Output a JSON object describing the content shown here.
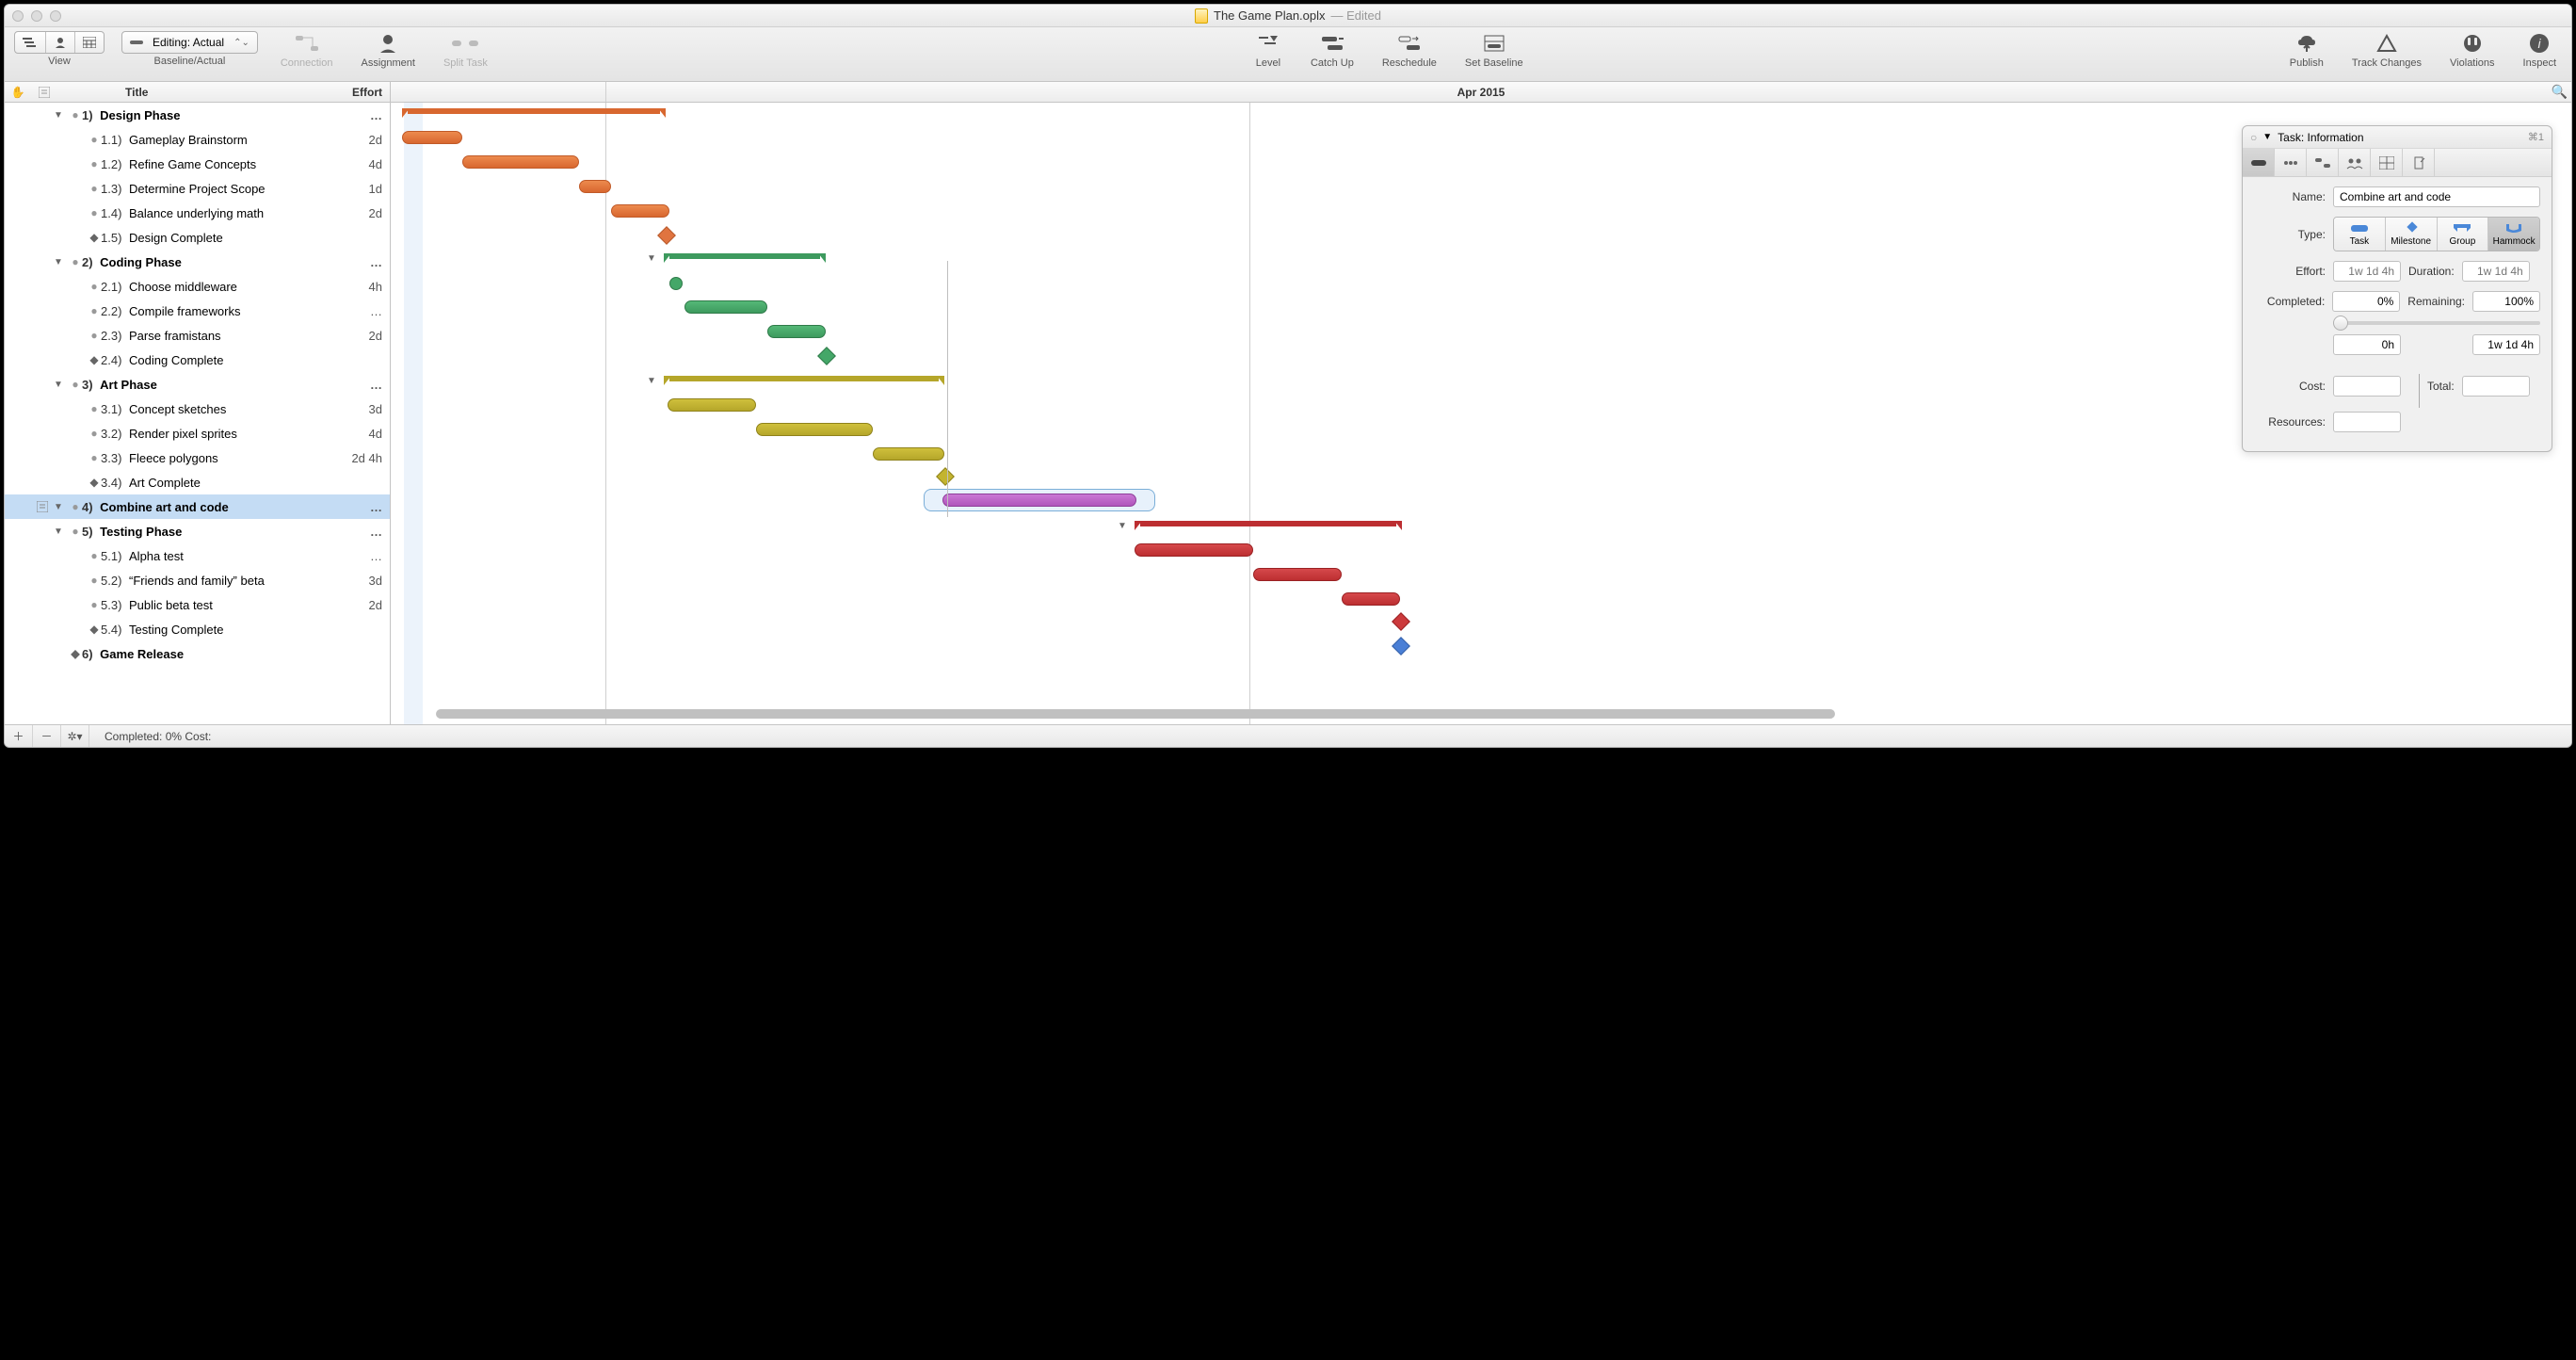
{
  "window": {
    "title": "The Game Plan.oplx",
    "edited": "— Edited"
  },
  "toolbar": {
    "view_label": "View",
    "baseline_label": "Baseline/Actual",
    "editing_dropdown": "Editing: Actual",
    "connection": "Connection",
    "assignment": "Assignment",
    "split_task": "Split Task",
    "level": "Level",
    "catch_up": "Catch Up",
    "reschedule": "Reschedule",
    "set_baseline": "Set Baseline",
    "publish": "Publish",
    "track_changes": "Track Changes",
    "violations": "Violations",
    "inspect": "Inspect"
  },
  "header": {
    "title": "Title",
    "effort": "Effort",
    "timeline": "Apr 2015"
  },
  "outline": [
    {
      "lvl": 1,
      "type": "phase",
      "num": "1)",
      "title": "Design Phase",
      "effort": "…",
      "disc": "▼"
    },
    {
      "lvl": 2,
      "type": "task",
      "num": "1.1)",
      "title": "Gameplay Brainstorm",
      "effort": "2d"
    },
    {
      "lvl": 2,
      "type": "task",
      "num": "1.2)",
      "title": "Refine Game Concepts",
      "effort": "4d"
    },
    {
      "lvl": 2,
      "type": "task",
      "num": "1.3)",
      "title": "Determine Project Scope",
      "effort": "1d"
    },
    {
      "lvl": 2,
      "type": "task",
      "num": "1.4)",
      "title": "Balance underlying math",
      "effort": "2d"
    },
    {
      "lvl": 2,
      "type": "milestone",
      "num": "1.5)",
      "title": "Design Complete",
      "effort": ""
    },
    {
      "lvl": 1,
      "type": "phase",
      "num": "2)",
      "title": "Coding Phase",
      "effort": "…",
      "disc": "▼"
    },
    {
      "lvl": 2,
      "type": "task",
      "num": "2.1)",
      "title": "Choose middleware",
      "effort": "4h"
    },
    {
      "lvl": 2,
      "type": "task",
      "num": "2.2)",
      "title": "Compile frameworks",
      "effort": "…"
    },
    {
      "lvl": 2,
      "type": "task",
      "num": "2.3)",
      "title": "Parse framistans",
      "effort": "2d"
    },
    {
      "lvl": 2,
      "type": "milestone",
      "num": "2.4)",
      "title": "Coding Complete",
      "effort": ""
    },
    {
      "lvl": 1,
      "type": "phase",
      "num": "3)",
      "title": "Art Phase",
      "effort": "…",
      "disc": "▼"
    },
    {
      "lvl": 2,
      "type": "task",
      "num": "3.1)",
      "title": "Concept sketches",
      "effort": "3d"
    },
    {
      "lvl": 2,
      "type": "task",
      "num": "3.2)",
      "title": "Render pixel sprites",
      "effort": "4d"
    },
    {
      "lvl": 2,
      "type": "task",
      "num": "3.3)",
      "title": "Fleece polygons",
      "effort": "2d 4h"
    },
    {
      "lvl": 2,
      "type": "milestone",
      "num": "3.4)",
      "title": "Art Complete",
      "effort": ""
    },
    {
      "lvl": 1,
      "type": "hammock",
      "num": "4)",
      "title": "Combine art and code",
      "effort": "…",
      "disc": "▼",
      "selected": true,
      "note": true
    },
    {
      "lvl": 1,
      "type": "phase",
      "num": "5)",
      "title": "Testing Phase",
      "effort": "…",
      "disc": "▼"
    },
    {
      "lvl": 2,
      "type": "task",
      "num": "5.1)",
      "title": "Alpha test",
      "effort": "…"
    },
    {
      "lvl": 2,
      "type": "task",
      "num": "5.2)",
      "title": "“Friends and family” beta",
      "effort": "3d"
    },
    {
      "lvl": 2,
      "type": "task",
      "num": "5.3)",
      "title": "Public beta test",
      "effort": "2d"
    },
    {
      "lvl": 2,
      "type": "milestone",
      "num": "5.4)",
      "title": "Testing Complete",
      "effort": ""
    },
    {
      "lvl": 1,
      "type": "milestone",
      "num": "6)",
      "title": "Game Release",
      "effort": ""
    }
  ],
  "inspector": {
    "title": "Task: Information",
    "shortcut": "⌘1",
    "name_label": "Name:",
    "name_value": "Combine art and code",
    "type_label": "Type:",
    "type_task": "Task",
    "type_milestone": "Milestone",
    "type_group": "Group",
    "type_hammock": "Hammock",
    "effort_label": "Effort:",
    "effort_ph": "1w 1d 4h",
    "duration_label": "Duration:",
    "duration_ph": "1w 1d 4h",
    "completed_label": "Completed:",
    "completed_value": "0%",
    "remaining_label": "Remaining:",
    "remaining_value": "100%",
    "done_hours": "0h",
    "remain_time": "1w 1d 4h",
    "cost_label": "Cost:",
    "resources_label": "Resources:",
    "total_label": "Total:"
  },
  "statusbar": {
    "text": "Completed: 0% Cost:"
  }
}
